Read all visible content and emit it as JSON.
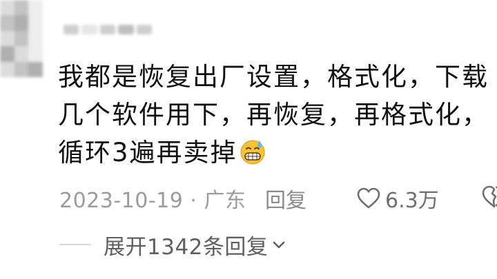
{
  "comment": {
    "lines": [
      "我都是恢复出厂设置，格式化，下载",
      "几个软件用下，再恢复，再格式化，",
      "循环3遍再卖掉"
    ],
    "emoji_icon": "grimacing-sweat-emoji-icon",
    "date_location": "2023-10-19 · 广东",
    "reply_label": "回复",
    "like_count": "6.3万",
    "expand_replies_label": "展开1342条回复"
  },
  "colors": {
    "text_primary": "#111111",
    "text_meta": "#9b9b9b",
    "text_expand": "#5f5f5f",
    "icon_stroke": "#6f6f6f",
    "emoji_face": "#f7c234"
  }
}
